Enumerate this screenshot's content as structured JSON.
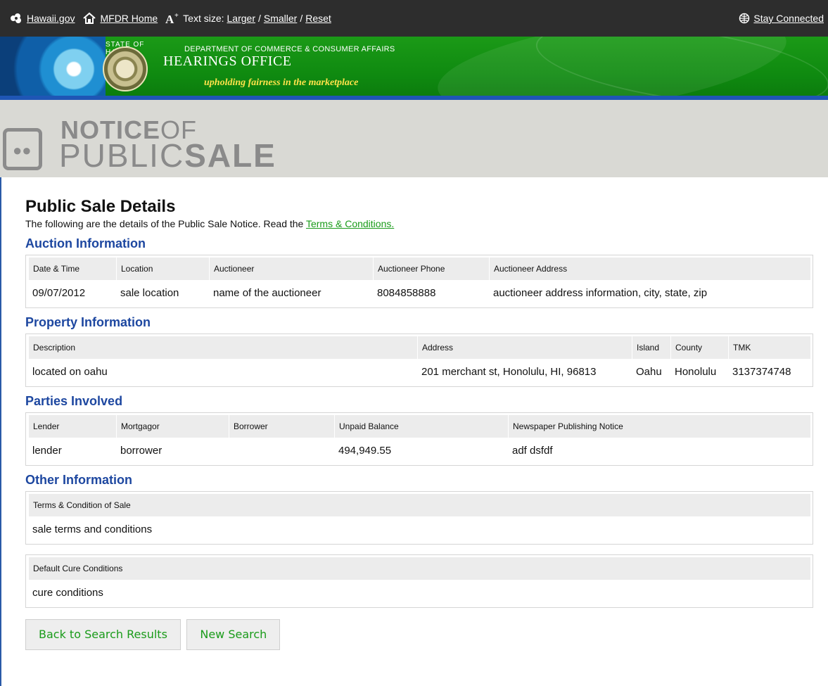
{
  "topbar": {
    "hawaii_link": "Hawaii.gov",
    "home_link": "MFDR Home",
    "text_size_label": "Text size:",
    "larger": "Larger",
    "smaller": "Smaller",
    "reset": "Reset",
    "stay_connected": "Stay Connected"
  },
  "banner": {
    "state_text": "STATE OF HAWAII",
    "department": "DEPARTMENT OF COMMERCE & CONSUMER AFFAIRS",
    "title": "HEARINGS OFFICE",
    "slogan": "upholding fairness in the marketplace"
  },
  "notice_header": {
    "line1_bold": "NOTICE",
    "line1_light": "OF",
    "line2_light": "PUBLIC",
    "line2_bold": "SALE"
  },
  "page": {
    "title": "Public Sale Details",
    "intro": "The following are the details of the Public Sale Notice. Read the",
    "terms_link": "Terms & Conditions."
  },
  "auction": {
    "title": "Auction Information",
    "headers": [
      "Date & Time",
      "Location",
      "Auctioneer",
      "Auctioneer Phone",
      "Auctioneer Address"
    ],
    "row": [
      "09/07/2012",
      "sale location",
      "name of the auctioneer",
      "8084858888",
      "auctioneer address information, city, state, zip"
    ]
  },
  "property": {
    "title": "Property Information",
    "headers": [
      "Description",
      "Address",
      "Island",
      "County",
      "TMK"
    ],
    "row": [
      "located on oahu",
      "201 merchant st, Honolulu, HI, 96813",
      "Oahu",
      "Honolulu",
      "3137374748"
    ]
  },
  "parties": {
    "title": "Parties Involved",
    "headers": [
      "Lender",
      "Mortgagor",
      "Borrower",
      "Unpaid Balance",
      "Newspaper Publishing Notice"
    ],
    "row": [
      "lender",
      "borrower",
      "",
      "494,949.55",
      "adf dsfdf"
    ]
  },
  "other": {
    "title": "Other Information",
    "terms_header": "Terms & Condition of Sale",
    "terms_value": "sale terms and conditions",
    "cure_header": "Default Cure Conditions",
    "cure_value": "cure conditions"
  },
  "buttons": {
    "back": "Back to Search Results",
    "new_search": "New Search"
  },
  "colors": {
    "topbar_bg": "#2d2d2d",
    "banner_green": "#0f8a10",
    "section_title_blue": "#1d47a0",
    "link_green": "#1a9b1a"
  }
}
